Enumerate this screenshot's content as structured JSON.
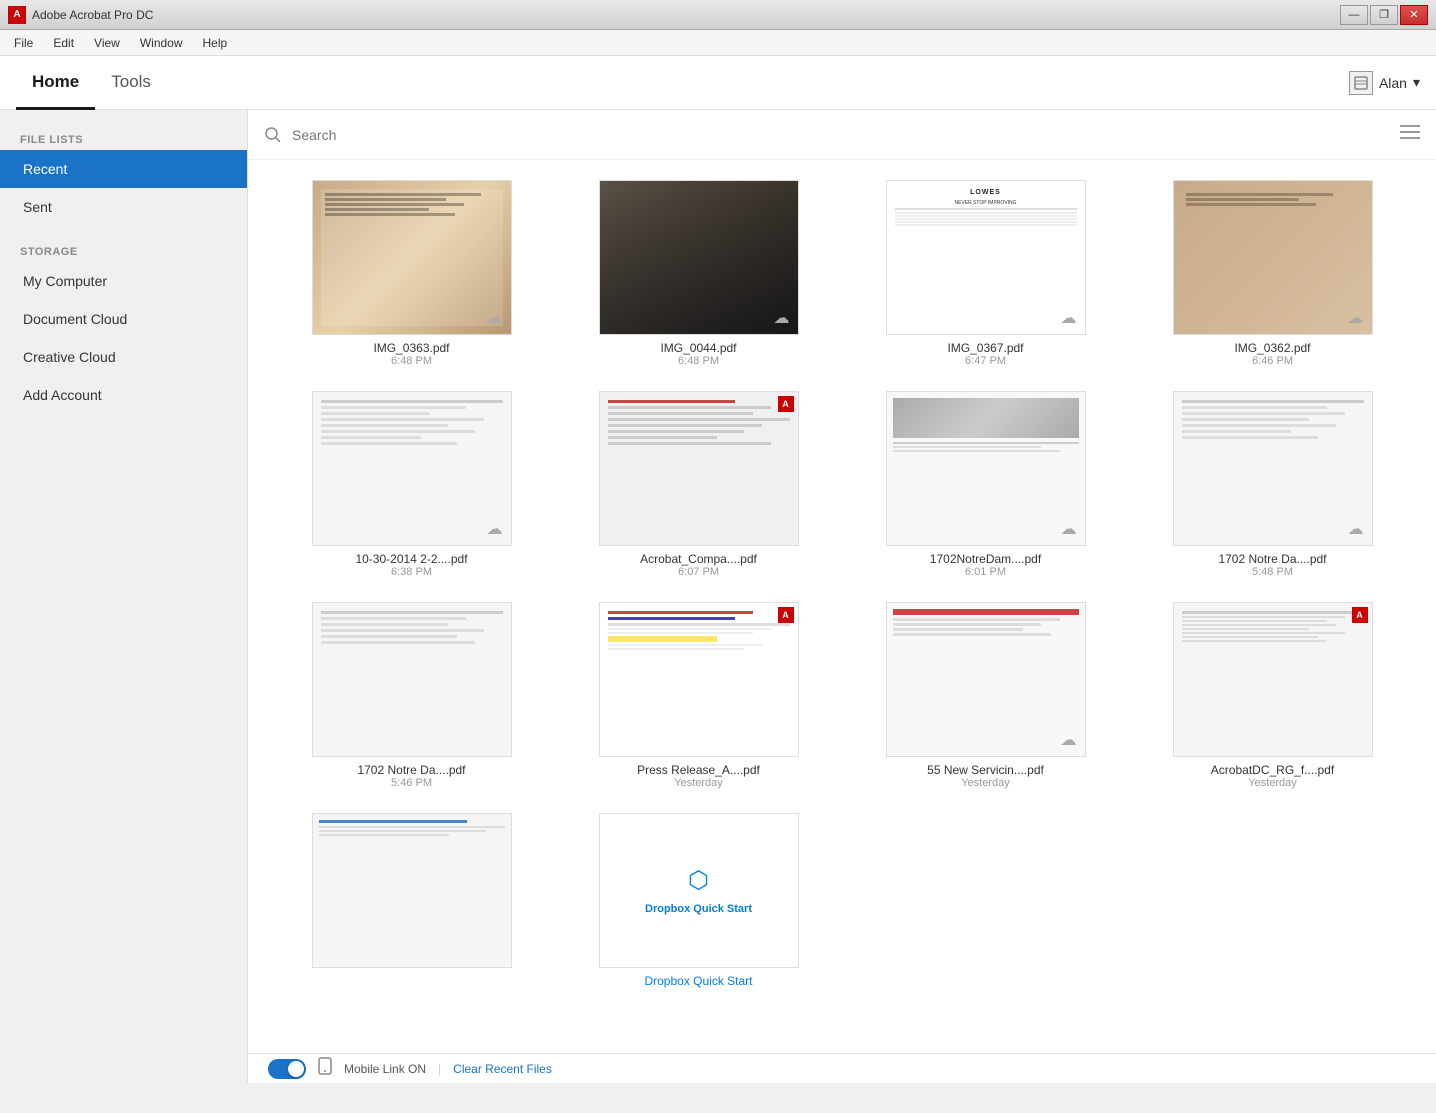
{
  "titlebar": {
    "app_name": "Adobe Acrobat Pro DC",
    "icon_label": "A",
    "minimize": "—",
    "restore": "❐",
    "close": "✕"
  },
  "menubar": {
    "items": [
      "File",
      "Edit",
      "View",
      "Window",
      "Help"
    ]
  },
  "navbar": {
    "tabs": [
      {
        "id": "home",
        "label": "Home",
        "active": true
      },
      {
        "id": "tools",
        "label": "Tools",
        "active": false
      }
    ],
    "user_name": "Alan",
    "user_icon": "☰"
  },
  "sidebar": {
    "file_lists_label": "FILE LISTS",
    "storage_label": "STORAGE",
    "file_list_items": [
      {
        "id": "recent",
        "label": "Recent",
        "active": true
      },
      {
        "id": "sent",
        "label": "Sent",
        "active": false
      }
    ],
    "storage_items": [
      {
        "id": "my-computer",
        "label": "My Computer"
      },
      {
        "id": "document-cloud",
        "label": "Document Cloud"
      },
      {
        "id": "creative-cloud",
        "label": "Creative Cloud"
      },
      {
        "id": "add-account",
        "label": "Add Account"
      }
    ]
  },
  "search": {
    "placeholder": "Search"
  },
  "files": [
    {
      "id": 1,
      "name": "IMG_0363.pdf",
      "time": "6:48 PM",
      "thumb": "receipt1",
      "cloud": true,
      "adobe": false
    },
    {
      "id": 2,
      "name": "IMG_0044.pdf",
      "time": "6:48 PM",
      "thumb": "receipt2",
      "cloud": true,
      "adobe": false
    },
    {
      "id": 3,
      "name": "IMG_0367.pdf",
      "time": "6:47 PM",
      "thumb": "receipt3",
      "cloud": true,
      "adobe": false
    },
    {
      "id": 4,
      "name": "IMG_0362.pdf",
      "time": "6:46 PM",
      "thumb": "receipt4",
      "cloud": true,
      "adobe": false
    },
    {
      "id": 5,
      "name": "10-30-2014 2-2....pdf",
      "time": "6:38 PM",
      "thumb": "doc1",
      "cloud": true,
      "adobe": false
    },
    {
      "id": 6,
      "name": "Acrobat_Compa....pdf",
      "time": "6:07 PM",
      "thumb": "doc2",
      "cloud": false,
      "adobe": true
    },
    {
      "id": 7,
      "name": "1702NotreDam....pdf",
      "time": "6:01 PM",
      "thumb": "doc3",
      "cloud": true,
      "adobe": false
    },
    {
      "id": 8,
      "name": "1702 Notre Da....pdf",
      "time": "5:48 PM",
      "thumb": "doc4",
      "cloud": true,
      "adobe": false
    },
    {
      "id": 9,
      "name": "1702 Notre Da....pdf",
      "time": "5:46 PM",
      "thumb": "doc5",
      "cloud": false,
      "adobe": false
    },
    {
      "id": 10,
      "name": "Press Release_A....pdf",
      "time": "Yesterday",
      "thumb": "doc6",
      "cloud": false,
      "adobe": true
    },
    {
      "id": 11,
      "name": "55 New Servicin....pdf",
      "time": "Yesterday",
      "thumb": "doc7",
      "cloud": true,
      "adobe": false
    },
    {
      "id": 12,
      "name": "AcrobatDC_RG_f....pdf",
      "time": "Yesterday",
      "thumb": "doc8",
      "cloud": false,
      "adobe": true
    },
    {
      "id": 13,
      "name": "",
      "time": "",
      "thumb": "doc9",
      "cloud": false,
      "adobe": false
    },
    {
      "id": 14,
      "name": "Dropbox Quick Start",
      "time": "",
      "thumb": "dropbox",
      "cloud": false,
      "adobe": false
    }
  ],
  "bottombar": {
    "mobile_link_label": "Mobile Link ON",
    "separator": "|",
    "clear_label": "Clear Recent Files"
  }
}
